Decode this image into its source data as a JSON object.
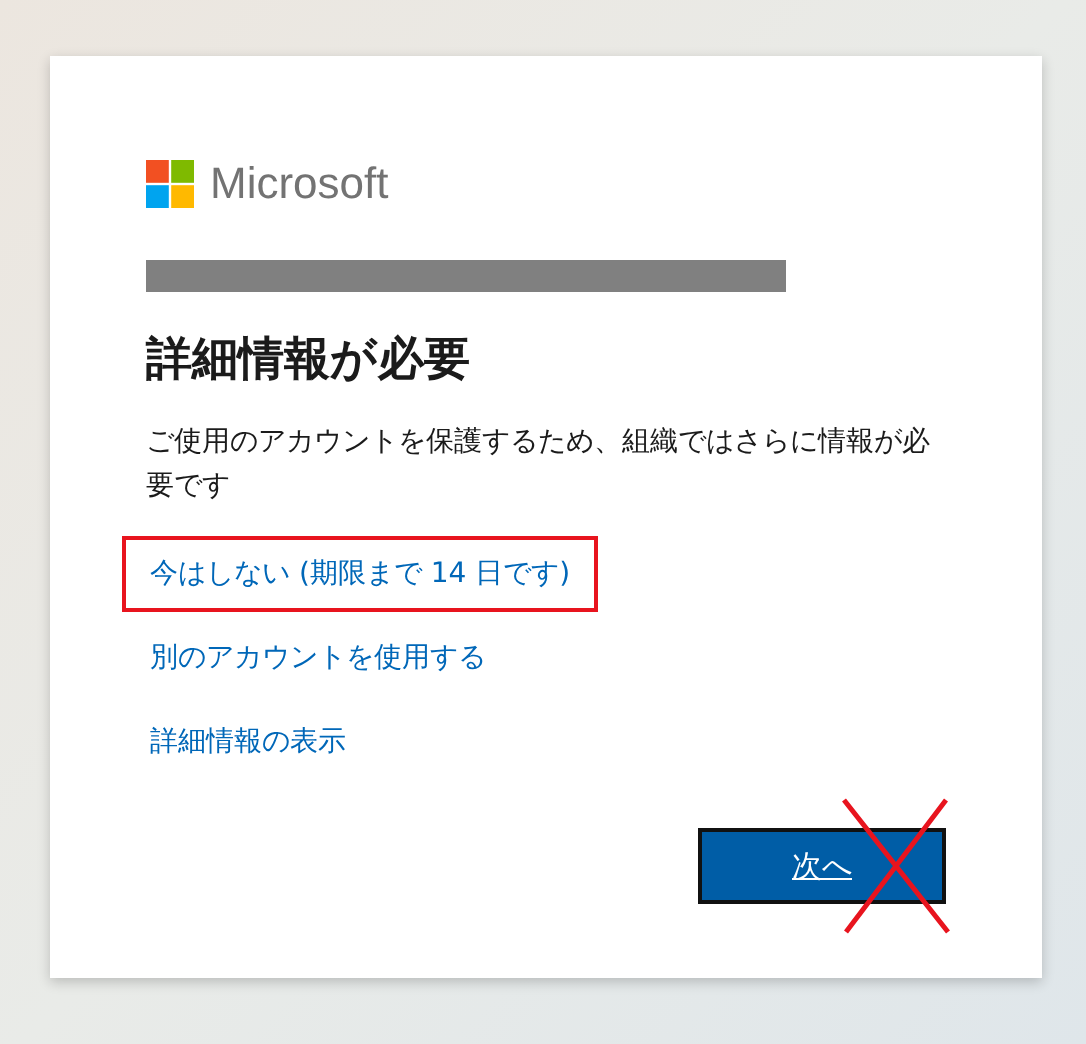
{
  "brand": {
    "name": "Microsoft"
  },
  "account": {
    "redacted": true
  },
  "title": "詳細情報が必要",
  "message": "ご使用のアカウントを保護するため、組織ではさらに情報が必要です",
  "links": [
    {
      "label": "今はしない (期限まで 14 日です)",
      "highlighted": true
    },
    {
      "label": "別のアカウントを使用する",
      "highlighted": false
    },
    {
      "label": "詳細情報の表示",
      "highlighted": false
    }
  ],
  "next_button": {
    "label": "次へ",
    "crossed_out": true
  }
}
